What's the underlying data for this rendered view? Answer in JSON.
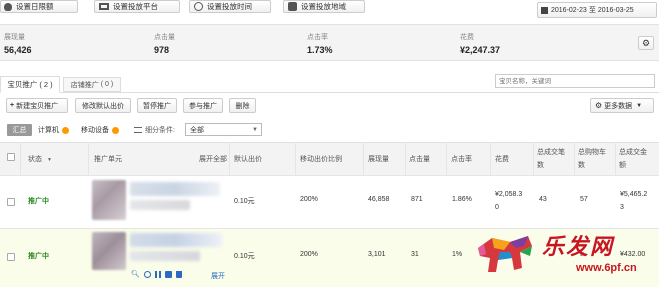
{
  "top_buttons": [
    {
      "label": "设置日限额",
      "icon": "money-bag-icon"
    },
    {
      "label": "设置投放平台",
      "icon": "monitor-icon"
    },
    {
      "label": "设置投放时间",
      "icon": "clock-icon"
    },
    {
      "label": "设置投放地域",
      "icon": "map-icon"
    }
  ],
  "date_range": {
    "start": "2016-02-23",
    "sep": "至",
    "end": "2016-03-25",
    "icon": "calendar-icon"
  },
  "stats": [
    {
      "label": "展现量",
      "value": "56,426"
    },
    {
      "label": "点击量",
      "value": "978"
    },
    {
      "label": "点击率",
      "value": "1.73%"
    },
    {
      "label": "花费",
      "value": "¥2,247.37"
    }
  ],
  "tabs": [
    {
      "label": "宝贝推广",
      "count": "( 2 )",
      "active": true
    },
    {
      "label": "店铺推广",
      "count": "( 0 )",
      "active": false
    }
  ],
  "search": {
    "placeholder": "宝贝名称，关键词"
  },
  "toolbar": {
    "new_label": "新建宝贝推广",
    "edit_bid_label": "修改默认出价",
    "pause_label": "暂停推广",
    "join_label": "参与推广",
    "delete_label": "删除",
    "more_data_label": "更多数据"
  },
  "filter": {
    "summary_label": "汇总",
    "computer_label": "计算机",
    "mobile_label": "移动设备",
    "segment_label": "细分条件:",
    "segment_value": "全部"
  },
  "table": {
    "headers": {
      "status": "状态",
      "unit": "推广单元",
      "expand_all": "展开全部",
      "default_bid": "默认出价",
      "mobile_ratio": "移动出价比例",
      "impressions": "展现量",
      "clicks": "点击量",
      "ctr": "点击率",
      "cost": "花费",
      "total_deals_l1": "总成交笔",
      "total_deals_l2": "数",
      "total_carts_l1": "总购物车",
      "total_carts_l2": "数",
      "total_amount_l1": "总成交金",
      "total_amount_l2": "额"
    },
    "rows": [
      {
        "status": "推广中",
        "default_bid": "0.10元",
        "mobile_ratio": "200%",
        "impressions": "46,858",
        "clicks": "871",
        "ctr": "1.86%",
        "cost_l1": "¥2,058.3",
        "cost_l2": "0",
        "total_deals": "43",
        "total_carts": "57",
        "total_amount_l1": "¥5,465.2",
        "total_amount_l2": "3"
      },
      {
        "status": "推广中",
        "default_bid": "0.10元",
        "mobile_ratio": "200%",
        "impressions": "3,101",
        "clicks": "31",
        "ctr": "1%",
        "cost_l1": "",
        "cost_l2": "",
        "total_deals": "",
        "total_carts": "3",
        "total_amount_l1": "¥432.00",
        "total_amount_l2": "",
        "expand_label": "展开"
      }
    ]
  },
  "watermark": {
    "brand": "乐发网",
    "url": "www.6pf.cn"
  },
  "colors": {
    "active_status": "#2a8a1e",
    "highlight_row": "#fafde9",
    "accent": "#f60",
    "watermark_red": "#c8161d"
  }
}
